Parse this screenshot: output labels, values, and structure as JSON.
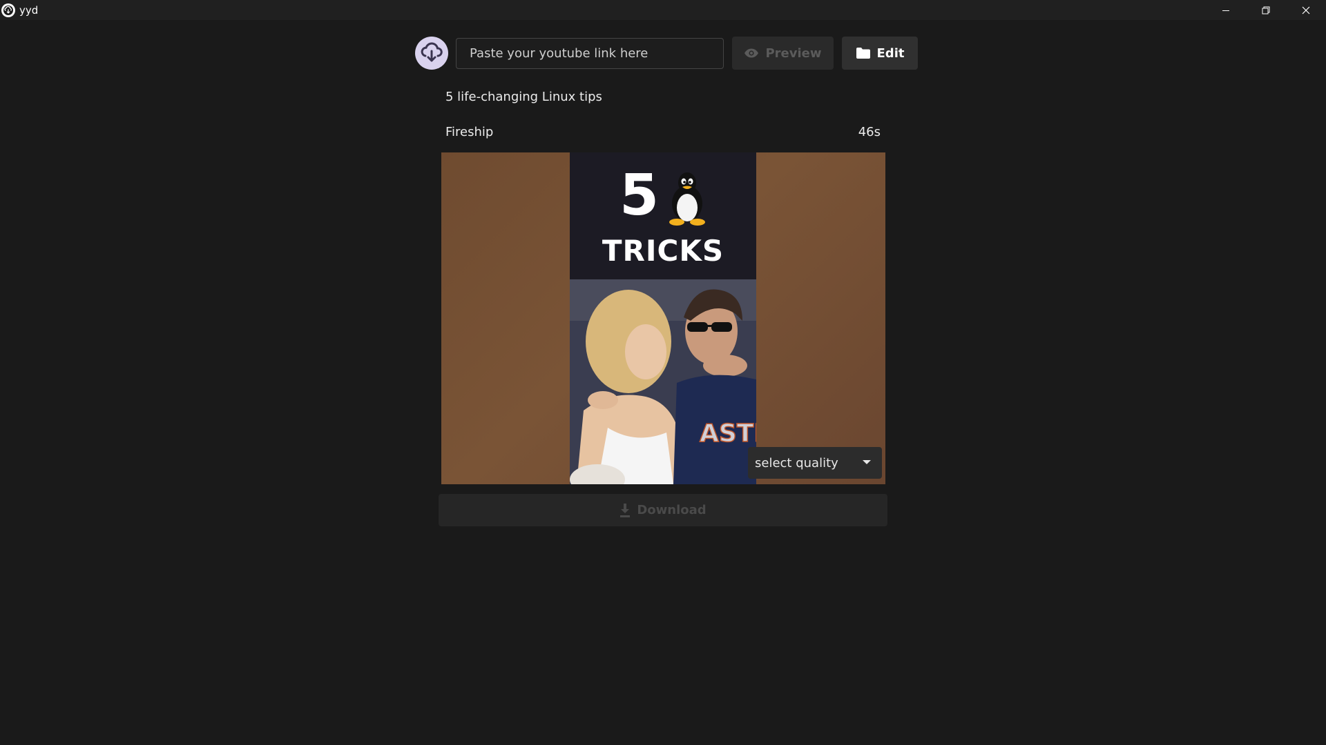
{
  "window": {
    "title": "yyd",
    "icon": "cloud-download-icon",
    "controls": {
      "minimize_icon": "minimize-icon",
      "restore_icon": "restore-icon",
      "close_icon": "close-icon"
    }
  },
  "toolbar": {
    "logo_icon": "cloud-download-icon",
    "url_input": {
      "value": "",
      "placeholder": "Paste your youtube link here"
    },
    "preview_label": "Preview",
    "preview_icon": "eye-icon",
    "preview_enabled": false,
    "edit_label": "Edit",
    "edit_icon": "folder-icon"
  },
  "video": {
    "title": "5 life-changing Linux tips",
    "channel": "Fireship",
    "duration": "46s",
    "thumbnail": {
      "headline_number": "5",
      "headline_word": "TRICKS",
      "penguin_icon": "tux-penguin-icon",
      "shirt_text": "ASTR"
    }
  },
  "quality": {
    "selected_label": "select quality",
    "caret_icon": "caret-down-icon"
  },
  "download": {
    "label": "Download",
    "icon": "download-icon",
    "enabled": false
  },
  "colors": {
    "background": "#1a1a1a",
    "titlebar": "#202020",
    "logo_bg": "#d9d2ee",
    "thumb_side": "#74503a",
    "disabled_text": "#4a4a4a"
  }
}
